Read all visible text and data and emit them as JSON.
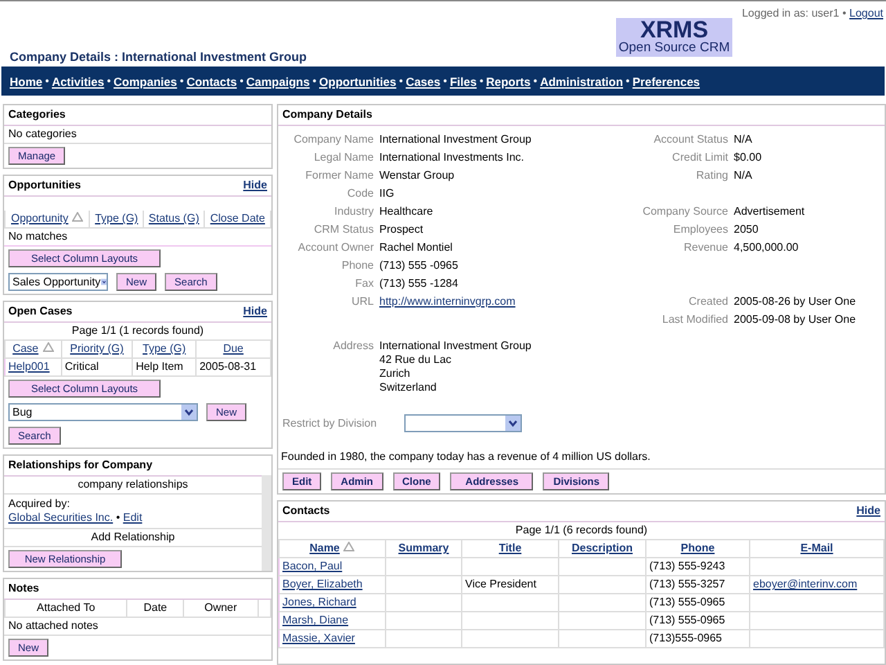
{
  "header": {
    "login_text": "Logged in as: user1",
    "separator": "•",
    "logout": "Logout",
    "logo_title": "XRMS",
    "logo_subtitle": "Open Source CRM",
    "page_title": "Company Details : International Investment Group"
  },
  "nav": [
    "Home",
    "Activities",
    "Companies",
    "Contacts",
    "Campaigns",
    "Opportunities",
    "Cases",
    "Files",
    "Reports",
    "Administration",
    "Preferences"
  ],
  "nav_separator": "•",
  "categories": {
    "title": "Categories",
    "empty": "No categories",
    "button": "Manage"
  },
  "opportunities": {
    "title": "Opportunities",
    "hide": "Hide",
    "columns": [
      {
        "label": "Opportunity",
        "sorted": true
      },
      {
        "label": "Type (G)",
        "sorted": false
      },
      {
        "label": "Status (G)",
        "sorted": false
      },
      {
        "label": "Close Date",
        "sorted": false
      }
    ],
    "empty": "No matches",
    "layout_button": "Select Column Layouts",
    "select": "Sales Opportunity",
    "buttons": [
      "New",
      "Search"
    ]
  },
  "open_cases": {
    "title": "Open Cases",
    "hide": "Hide",
    "pager": "Page 1/1 (1 records found)",
    "columns": [
      {
        "label": "Case",
        "sorted": true
      },
      {
        "label": "Priority (G)",
        "sorted": false
      },
      {
        "label": "Type (G)",
        "sorted": false
      },
      {
        "label": "Due",
        "sorted": false
      }
    ],
    "rows": [
      [
        "Help001",
        "Critical",
        "Help Item",
        "2005-08-31"
      ]
    ],
    "layout_button": "Select Column Layouts",
    "select": "Bug",
    "new_button": "New",
    "search_button": "Search"
  },
  "relationships": {
    "title": "Relationships for Company",
    "header": "company relationships",
    "acquired_label": "Acquired by:",
    "company_link": "Global Securities Inc.",
    "separator": "•",
    "edit_link": "Edit",
    "add_label": "Add Relationship",
    "button": "New Relationship"
  },
  "notes": {
    "title": "Notes",
    "columns": [
      "Attached To",
      "Date",
      "Owner"
    ],
    "empty": "No attached notes",
    "button": "New"
  },
  "company_details": {
    "title": "Company Details",
    "rows": [
      {
        "left": {
          "label": "Company Name",
          "value": "International Investment Group"
        },
        "right": {
          "label": "Account Status",
          "value": "N/A"
        }
      },
      {
        "left": {
          "label": "Legal Name",
          "value": "International Investments Inc."
        },
        "right": {
          "label": "Credit Limit",
          "value": "$0.00"
        }
      },
      {
        "left": {
          "label": "Former Name",
          "value": "Wenstar Group"
        },
        "right": {
          "label": "Rating",
          "value": "N/A"
        }
      },
      {
        "left": {
          "label": "Code",
          "value": "IIG"
        }
      },
      {
        "left": {
          "label": "Industry",
          "value": "Healthcare"
        },
        "right": {
          "label": "Company Source",
          "value": "Advertisement"
        }
      },
      {
        "left": {
          "label": "CRM Status",
          "value": "Prospect"
        },
        "right": {
          "label": "Employees",
          "value": "2050"
        }
      },
      {
        "left": {
          "label": "Account Owner",
          "value": "Rachel Montiel"
        },
        "right": {
          "label": "Revenue",
          "value": "4,500,000.00"
        }
      },
      {
        "left": {
          "label": "Phone",
          "value": "(713) 555 -0965"
        }
      },
      {
        "left": {
          "label": "Fax",
          "value": "(713) 555 -1284"
        }
      },
      {
        "left": {
          "label": "URL",
          "value": "http://www.interninvgrp.com",
          "kind": "link"
        },
        "right": {
          "label": "Created",
          "value": "2005-08-26 by User One"
        }
      },
      {
        "right": {
          "label": "Last Modified",
          "value": "2005-09-08 by User One"
        }
      }
    ],
    "address_label": "Address",
    "address_lines": [
      "International Investment Group",
      "42 Rue du Lac",
      "Zurich",
      "Switzerland"
    ],
    "division_label": "Restrict by Division",
    "description": "Founded in 1980, the company today has a revenue of 4 million US dollars.",
    "buttons": [
      "Edit",
      "Admin",
      "Clone",
      "Addresses",
      "Divisions"
    ]
  },
  "contacts": {
    "title": "Contacts",
    "hide": "Hide",
    "pager": "Page 1/1 (6 records found)",
    "columns": [
      {
        "label": "Name",
        "sorted": true
      },
      {
        "label": "Summary",
        "sorted": false
      },
      {
        "label": "Title",
        "sorted": false
      },
      {
        "label": "Description",
        "sorted": false
      },
      {
        "label": "Phone",
        "sorted": false
      },
      {
        "label": "E-Mail",
        "sorted": false
      }
    ],
    "rows": [
      {
        "name": "Bacon, Paul",
        "title": "",
        "phone": "(713) 555-9243",
        "email": ""
      },
      {
        "name": "Boyer, Elizabeth",
        "title": "Vice President",
        "phone": "(713) 555-3257",
        "email": "eboyer@interinv.com"
      },
      {
        "name": "Jones, Richard",
        "title": "",
        "phone": "(713) 555-0965",
        "email": ""
      },
      {
        "name": "Marsh, Diane",
        "title": "",
        "phone": "(713) 555-0965",
        "email": ""
      },
      {
        "name": "Massie, Xavier",
        "title": "",
        "phone": "(713)555-0965",
        "email": ""
      }
    ]
  }
}
